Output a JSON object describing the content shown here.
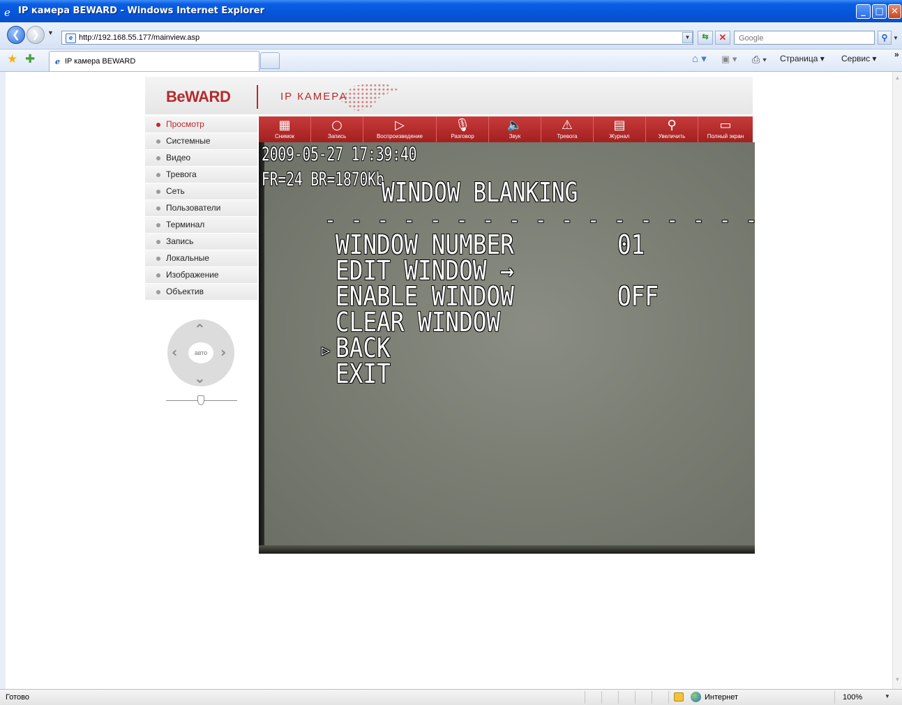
{
  "window": {
    "title": "IP камера BEWARD - Windows Internet Explorer",
    "min": "_",
    "max": "□",
    "close": "✕"
  },
  "address": {
    "back": "❮",
    "forward": "❯",
    "url": "http://192.168.55.177/mainview.asp",
    "search_placeholder": "Google"
  },
  "tabs": [
    {
      "label": "IP камера BEWARD"
    }
  ],
  "commands": {
    "page": "Страница ▾",
    "tools": "Сервис ▾"
  },
  "header": {
    "logo": "BeWARD",
    "product": "IP КАМЕРА"
  },
  "sidebar": {
    "items": [
      {
        "label": "Просмотр",
        "active": true
      },
      {
        "label": "Системные"
      },
      {
        "label": "Видео"
      },
      {
        "label": "Тревога"
      },
      {
        "label": "Сеть"
      },
      {
        "label": "Пользователи"
      },
      {
        "label": "Терминал"
      },
      {
        "label": "Запись"
      },
      {
        "label": "Локальные"
      },
      {
        "label": "Изображение"
      },
      {
        "label": "Объектив"
      }
    ]
  },
  "ptz": {
    "center_label": "авто"
  },
  "toolbar": {
    "buttons": [
      {
        "label": "Снимок",
        "icon": "snapshot-icon"
      },
      {
        "label": "Запись",
        "icon": "record-icon"
      },
      {
        "label": "Воспроизведение",
        "icon": "play-icon"
      },
      {
        "label": "Разговор",
        "icon": "microphone-icon"
      },
      {
        "label": "Звук",
        "icon": "speaker-icon"
      },
      {
        "label": "Тревога",
        "icon": "alarm-icon"
      },
      {
        "label": "Журнал",
        "icon": "log-icon"
      },
      {
        "label": "Увеличить",
        "icon": "zoom-icon"
      },
      {
        "label": "Полный экран",
        "icon": "fullscreen-icon"
      }
    ]
  },
  "video": {
    "timestamp": "2009-05-27  17:39:40",
    "stats": "FR=24 BR=1870Kb",
    "menu_title": "WINDOW BLANKING",
    "divider": "- - - - - - - - - - - - - - - - - - - - -",
    "menu": [
      {
        "label": "WINDOW NUMBER",
        "value": "01"
      },
      {
        "label": "EDIT WINDOW →",
        "value": ""
      },
      {
        "label": "ENABLE WINDOW",
        "value": "OFF"
      },
      {
        "label": "CLEAR WINDOW",
        "value": ""
      },
      {
        "label": "BACK",
        "value": "",
        "selected": true
      },
      {
        "label": "EXIT",
        "value": ""
      }
    ],
    "cursor": "▷"
  },
  "status": {
    "text": "Готово",
    "zone": "Интернет",
    "zoom": "100%"
  }
}
